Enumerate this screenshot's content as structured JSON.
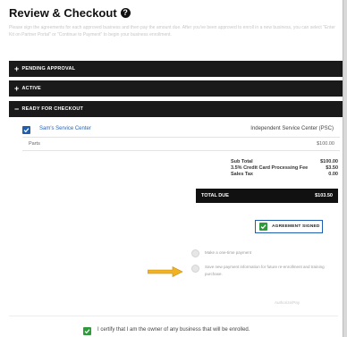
{
  "page": {
    "title": "Review & Checkout",
    "instructions": "Please sign the agreements for each approved business and then pay the amount due. After you've been approved to enroll in a new business, you can select \"Enter Kit on Partner Portal\" or \"Continue to Payment\" to begin your business enrollment."
  },
  "sections": {
    "pending": {
      "symbol": "+",
      "label": "Pending Approval"
    },
    "active": {
      "symbol": "+",
      "label": "Active"
    },
    "ready": {
      "symbol": "−",
      "label": "Ready for Checkout"
    }
  },
  "vendor": {
    "name": "Sam's Service Center",
    "type": "Independent Service Center (PSC)",
    "parts_label": "Parts",
    "parts_value": "$100.00"
  },
  "summary": {
    "subtotal_label": "Sub Total",
    "subtotal_value": "$100.00",
    "fee_label": "3.5% Credit Card Processing Fee",
    "fee_value": "$3.50",
    "tax_label": "Sales Tax",
    "tax_value": "0.00",
    "total_label": "TOTAL DUE",
    "total_value": "$103.50"
  },
  "agreement": {
    "label": "AGREEMENT SIGNED"
  },
  "payment_options": {
    "one_time": "Make a one-time payment",
    "save": "Save new payment information for future re-enrollment and training purchase."
  },
  "authorize": {
    "label": "Authorize/Pay"
  },
  "certify": {
    "text": "I certify that I am the owner of any business that will be enrolled."
  },
  "colors": {
    "section_bar": "#1a1a1a",
    "link_blue": "#2a63b2",
    "check_green": "#2e9a3c",
    "arrow": "#f0b323"
  }
}
